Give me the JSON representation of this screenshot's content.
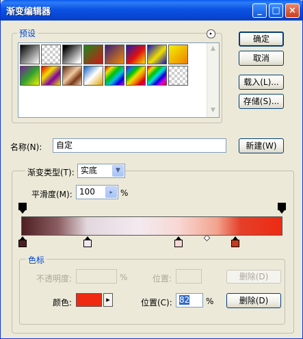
{
  "window": {
    "title": "渐变编辑器",
    "minimize": "_",
    "maximize": "□",
    "close": "×"
  },
  "presets": {
    "label": "预设",
    "flyout": "▸",
    "scroll_up": "▲",
    "scroll_down": "▼"
  },
  "buttons": {
    "ok": "确定",
    "cancel": "取消",
    "load": "载入(L)...",
    "save": "存储(S)...",
    "new": "新建(W)",
    "delete_opacity": "删除(D)",
    "delete_color": "删除(D)"
  },
  "name": {
    "label": "名称(N):",
    "value": "自定"
  },
  "gradient": {
    "type_label": "渐变类型(T):",
    "type_value": "实底",
    "smoothness_label": "平滑度(M):",
    "smoothness_value": "100",
    "smoothness_unit": "%"
  },
  "stops": {
    "group_label": "色标",
    "opacity_label": "不透明度:",
    "opacity_unit": "%",
    "position_label_disabled": "位置:",
    "color_label": "颜色:",
    "color_value": "#ee2a12",
    "position_label": "位置(C):",
    "position_value": "82",
    "position_unit": "%"
  },
  "icons": {
    "dropdown_arrow": "▼",
    "color_picker_arrow": "▸"
  }
}
